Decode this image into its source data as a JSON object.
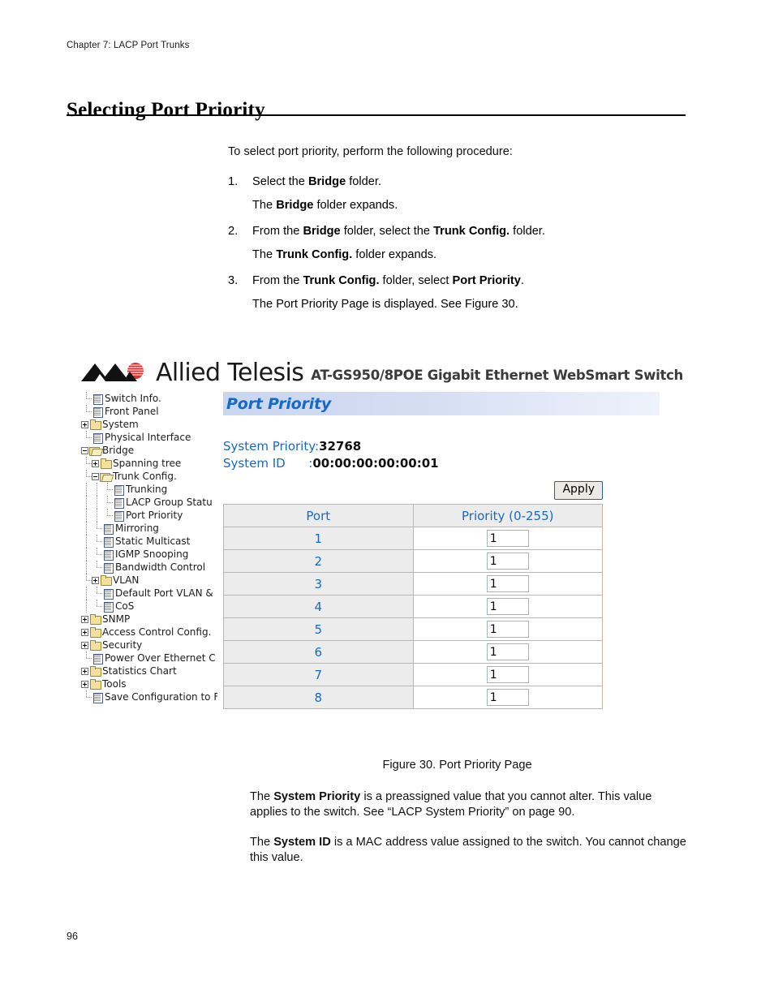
{
  "document": {
    "running_head": "Chapter 7: LACP Port Trunks",
    "page_number": "96",
    "section_heading": "Selecting Port Priority",
    "intro": "To select port priority, perform the following procedure:",
    "steps": [
      {
        "number": "1.",
        "text_parts": [
          "Select the ",
          "Bridge",
          " folder."
        ],
        "followup_parts": [
          "The ",
          "Bridge",
          " folder expands."
        ]
      },
      {
        "number": "2.",
        "text_parts": [
          "From the ",
          "Bridge",
          " folder, select the ",
          "Trunk Config.",
          " folder."
        ],
        "followup_parts": [
          "The ",
          "Trunk Config.",
          " folder expands."
        ]
      },
      {
        "number": "3.",
        "text_parts": [
          "From the ",
          "Trunk Config.",
          " folder, select ",
          "Port Priority",
          "."
        ],
        "followup_parts": [
          "The Port Priority Page is displayed. See Figure 30."
        ]
      }
    ],
    "figure_caption": "Figure 30. Port Priority Page",
    "closing_paragraphs": [
      [
        "The ",
        "System Priority",
        " is a preassigned value that you cannot alter. This value applies to the switch. See “LACP System Priority” on page 90."
      ],
      [
        "The ",
        "System ID",
        " is a MAC address value assigned to the switch. You cannot change this value."
      ]
    ]
  },
  "screenshot": {
    "brand": "Allied Telesis",
    "model": "AT-GS950/8POE Gigabit Ethernet WebSmart Switch",
    "page_title": "Port Priority",
    "colors": {
      "title_text": "#1769c8",
      "title_bar_start": "#c9d6f0",
      "title_bar_end": "#eef2fb",
      "logo_red": "#d9322c",
      "table_border": "#bdb8a6",
      "table_header_bg": "#ececec"
    },
    "tree": {
      "items": [
        {
          "label": "Switch Info.",
          "indent": 1,
          "icon": "page-icon",
          "toggle": "none"
        },
        {
          "label": "Front Panel",
          "indent": 1,
          "icon": "page-icon",
          "toggle": "none"
        },
        {
          "label": "System",
          "indent": 0,
          "icon": "folder-icon",
          "toggle": "plus"
        },
        {
          "label": "Physical Interface",
          "indent": 1,
          "icon": "page-icon",
          "toggle": "none"
        },
        {
          "label": "Bridge",
          "indent": 0,
          "icon": "folder-open-icon",
          "toggle": "minus"
        },
        {
          "label": "Spanning tree",
          "indent": 1,
          "icon": "folder-icon",
          "toggle": "plus"
        },
        {
          "label": "Trunk Config.",
          "indent": 1,
          "icon": "folder-open-icon",
          "toggle": "minus"
        },
        {
          "label": "Trunking",
          "indent": 3,
          "icon": "page-icon",
          "toggle": "none"
        },
        {
          "label": "LACP Group Statu",
          "indent": 3,
          "icon": "page-icon",
          "toggle": "none"
        },
        {
          "label": "Port Priority",
          "indent": 3,
          "icon": "page-icon",
          "toggle": "none"
        },
        {
          "label": "Mirroring",
          "indent": 2,
          "icon": "page-icon",
          "toggle": "none"
        },
        {
          "label": "Static Multicast",
          "indent": 2,
          "icon": "page-icon",
          "toggle": "none"
        },
        {
          "label": "IGMP Snooping",
          "indent": 2,
          "icon": "page-icon",
          "toggle": "none"
        },
        {
          "label": "Bandwidth Control",
          "indent": 2,
          "icon": "page-icon",
          "toggle": "none"
        },
        {
          "label": "VLAN",
          "indent": 1,
          "icon": "folder-icon",
          "toggle": "plus"
        },
        {
          "label": "Default Port VLAN &",
          "indent": 2,
          "icon": "page-icon",
          "toggle": "none"
        },
        {
          "label": "CoS",
          "indent": 2,
          "icon": "page-icon",
          "toggle": "none"
        },
        {
          "label": "SNMP",
          "indent": 0,
          "icon": "folder-icon",
          "toggle": "plus"
        },
        {
          "label": "Access Control Config.",
          "indent": 0,
          "icon": "folder-icon",
          "toggle": "plus"
        },
        {
          "label": "Security",
          "indent": 0,
          "icon": "folder-icon",
          "toggle": "plus"
        },
        {
          "label": "Power Over Ethernet C",
          "indent": 1,
          "icon": "page-icon",
          "toggle": "none"
        },
        {
          "label": "Statistics Chart",
          "indent": 0,
          "icon": "folder-icon",
          "toggle": "plus"
        },
        {
          "label": "Tools",
          "indent": 0,
          "icon": "folder-icon",
          "toggle": "plus"
        },
        {
          "label": "Save Configuration to F",
          "indent": 1,
          "icon": "page-icon",
          "toggle": "none"
        }
      ]
    },
    "system": {
      "priority_label": "System Priority:",
      "priority_value": "32768",
      "id_label": "System ID      :",
      "id_value": "00:00:00:00:00:01"
    },
    "apply_label": "Apply",
    "table": {
      "headers": [
        "Port",
        "Priority (0-255)"
      ],
      "rows": [
        {
          "port": "1",
          "priority": "1"
        },
        {
          "port": "2",
          "priority": "1"
        },
        {
          "port": "3",
          "priority": "1"
        },
        {
          "port": "4",
          "priority": "1"
        },
        {
          "port": "5",
          "priority": "1"
        },
        {
          "port": "6",
          "priority": "1"
        },
        {
          "port": "7",
          "priority": "1"
        },
        {
          "port": "8",
          "priority": "1"
        }
      ]
    }
  }
}
